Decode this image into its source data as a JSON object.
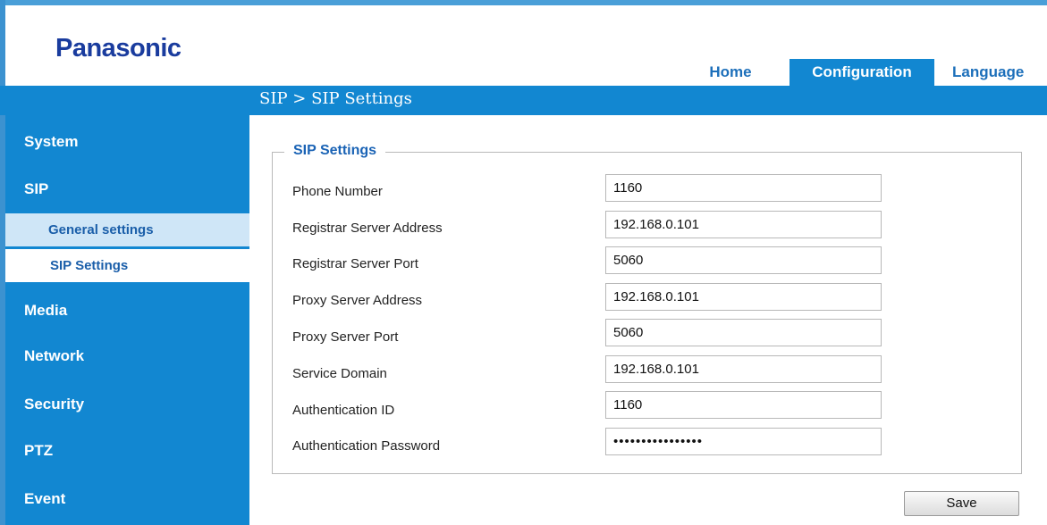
{
  "brand": {
    "logo": "Panasonic"
  },
  "top_nav": {
    "home": "Home",
    "configuration": "Configuration",
    "language": "Language"
  },
  "breadcrumb": "SIP  > SIP Settings",
  "sidebar": {
    "system": "System",
    "sip": "SIP",
    "general_settings": "General settings",
    "sip_settings": "SIP Settings",
    "media": "Media",
    "network": "Network",
    "security": "Security",
    "ptz": "PTZ",
    "event": "Event"
  },
  "form": {
    "legend": "SIP Settings",
    "fields": [
      {
        "label": "Phone Number",
        "value": "1160"
      },
      {
        "label": "Registrar Server Address",
        "value": "192.168.0.101"
      },
      {
        "label": "Registrar Server Port",
        "value": "5060"
      },
      {
        "label": "Proxy Server Address",
        "value": "192.168.0.101"
      },
      {
        "label": "Proxy Server Port",
        "value": "5060"
      },
      {
        "label": "Service Domain",
        "value": "192.168.0.101"
      },
      {
        "label": "Authentication ID",
        "value": "1160"
      },
      {
        "label": "Authentication Password",
        "value": "••••••••••••••••"
      }
    ],
    "save_label": "Save"
  },
  "colors": {
    "primary_blue": "#1287d1",
    "logo_blue": "#1a3c9e",
    "active_sub_bg": "#cfe6f7"
  }
}
